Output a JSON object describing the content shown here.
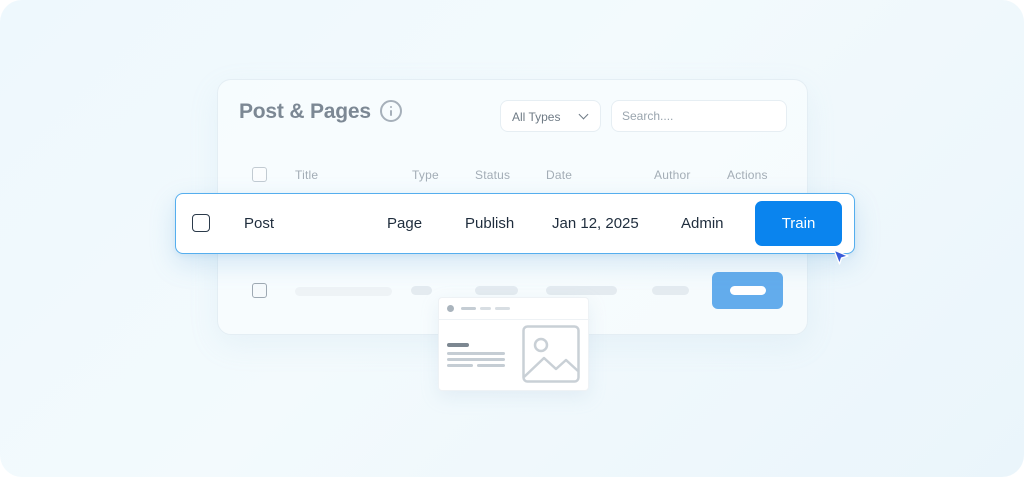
{
  "card": {
    "title": "Post & Pages",
    "type_filter": "All Types",
    "search_placeholder": "Search...."
  },
  "table": {
    "columns": [
      "Title",
      "Type",
      "Status",
      "Date",
      "Author",
      "Actions"
    ]
  },
  "highlight_row": {
    "title": "Post",
    "type": "Page",
    "status": "Publish",
    "date": "Jan 12, 2025",
    "author": "Admin",
    "action_label": "Train"
  },
  "icons": {
    "info": "info-icon",
    "chevron": "chevron-down-icon",
    "image": "image-icon",
    "cursor": "cursor-icon"
  },
  "colors": {
    "accent": "#0a84ee",
    "row_border": "#55aeee",
    "background": "#eef8fd"
  }
}
